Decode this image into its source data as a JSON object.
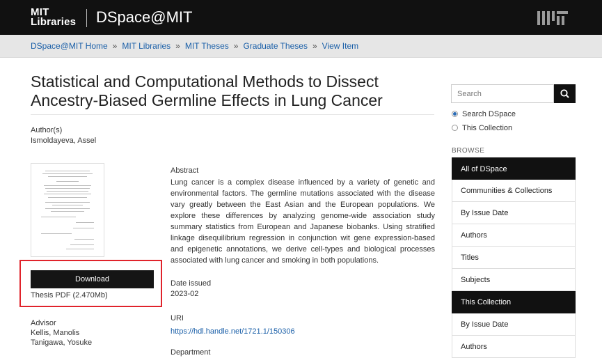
{
  "header": {
    "logo_line1": "MIT",
    "logo_line2": "Libraries",
    "site_title": "DSpace@MIT",
    "brand_mark": "mit-logo-mark"
  },
  "breadcrumb": [
    "DSpace@MIT Home",
    "MIT Libraries",
    "MIT Theses",
    "Graduate Theses",
    "View Item"
  ],
  "breadcrumb_separator": "»",
  "item": {
    "title": "Statistical and Computational Methods to Dissect Ancestry-Biased Germline Effects in Lung Cancer",
    "authors_label": "Author(s)",
    "author": "Ismoldayeva, Assel",
    "download_label": "Download",
    "file_info": "Thesis PDF (2.470Mb)",
    "advisor_label": "Advisor",
    "advisors": [
      "Kellis, Manolis",
      "Tanigawa, Yosuke"
    ],
    "abstract_label": "Abstract",
    "abstract": "Lung cancer is a complex disease influenced by a variety of genetic and environmental factors. The germline mutations associated with the disease vary greatly between the East Asian and the European populations. We explore these differences by analyzing genome-wide association study summary statistics from European and Japanese biobanks. Using stratified linkage disequilibrium regression in conjunction wit gene expression-based and epigenetic annotations, we derive cell-types and biological processes associated with lung cancer and smoking in both populations.",
    "date_label": "Date issued",
    "date": "2023-02",
    "uri_label": "URI",
    "uri": "https://hdl.handle.net/1721.1/150306",
    "department_label": "Department"
  },
  "sidebar": {
    "search_placeholder": "Search",
    "scope_options": [
      {
        "label": "Search DSpace",
        "selected": true
      },
      {
        "label": "This Collection",
        "selected": false
      }
    ],
    "browse_label": "BROWSE",
    "browse_all_heading": "All of DSpace",
    "browse_all_items": [
      "Communities & Collections",
      "By Issue Date",
      "Authors",
      "Titles",
      "Subjects"
    ],
    "browse_collection_heading": "This Collection",
    "browse_collection_items": [
      "By Issue Date",
      "Authors"
    ]
  },
  "colors": {
    "header_bg": "#111111",
    "link": "#1a5fa8",
    "highlight_box": "#e0232b"
  }
}
